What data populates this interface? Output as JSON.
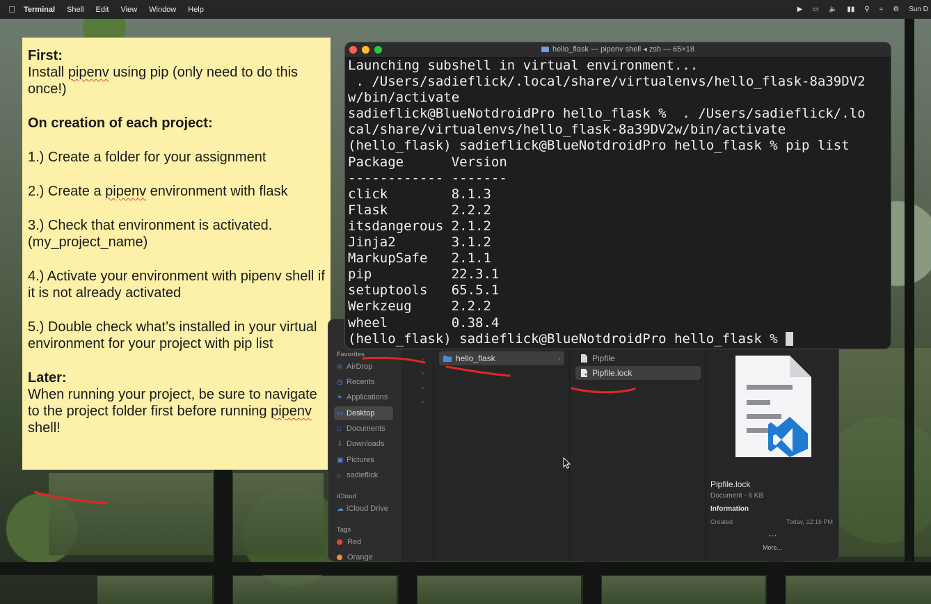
{
  "menubar": {
    "app": "Terminal",
    "items": [
      "Shell",
      "Edit",
      "View",
      "Window",
      "Help"
    ],
    "status_icons": [
      "play-icon",
      "display-icon",
      "volume-icon",
      "battery-icon",
      "search-icon",
      "wifi-icon",
      "control-center-icon"
    ],
    "clock": "Sun D"
  },
  "sticky": {
    "h1": "First:",
    "install_pre": "Install ",
    "install_word": "pipenv",
    "install_post": " using pip (only need to do this once!)",
    "h2": "On creation of each project:",
    "step1": "1.) Create a folder for your assignment",
    "step2_pre": "2.) Create a ",
    "step2_word": "pipenv",
    "step2_post": " environment with flask",
    "step3": "3.) Check that environment is activated. (my_project_name)",
    "step4": "4.) Activate your environment with pipenv shell if it is not already activated",
    "step5": "5.) Double check what’s installed in your virtual environment for your project with pip list",
    "h3": "Later:",
    "later_pre": "When running your project, be sure to navigate to the project folder first before running ",
    "later_word": "pipenv",
    "later_post": " shell!"
  },
  "terminal": {
    "title": "hello_flask — pipenv shell ◂ zsh — 65×18",
    "lines": [
      "Launching subshell in virtual environment...",
      " . /Users/sadieflick/.local/share/virtualenvs/hello_flask-8a39DV2",
      "w/bin/activate",
      "sadieflick@BlueNotdroidPro hello_flask %  . /Users/sadieflick/.lo",
      "cal/share/virtualenvs/hello_flask-8a39DV2w/bin/activate",
      "(hello_flask) sadieflick@BlueNotdroidPro hello_flask % pip list",
      "Package      Version",
      "------------ -------",
      "click        8.1.3",
      "Flask        2.2.2",
      "itsdangerous 2.1.2",
      "Jinja2       3.1.2",
      "MarkupSafe   2.1.1",
      "pip          22.3.1",
      "setuptools   65.5.1",
      "Werkzeug     2.2.2",
      "wheel        0.38.4",
      "(hello_flask) sadieflick@BlueNotdroidPro hello_flask % "
    ]
  },
  "finder": {
    "sidebar": {
      "favorites_label": "Favorites",
      "favorites": [
        "AirDrop",
        "Recents",
        "Applications",
        "Desktop",
        "Documents",
        "Downloads",
        "Pictures",
        "sadieflick"
      ],
      "selected": "Desktop",
      "icloud_label": "iCloud",
      "icloud": [
        "iCloud Drive"
      ],
      "tags_label": "Tags",
      "tags": [
        {
          "name": "Red",
          "color": "#e0443e"
        },
        {
          "name": "Orange",
          "color": "#f0912f"
        }
      ]
    },
    "column1": [
      {
        "name": "hello_flask",
        "kind": "folder"
      }
    ],
    "column2": [
      {
        "name": "Pipfile",
        "kind": "file"
      },
      {
        "name": "Pipfile.lock",
        "kind": "file"
      }
    ],
    "preview": {
      "name": "Pipfile.lock",
      "kind": "Document - 6 KB",
      "info_label": "Information",
      "created_label": "Created",
      "created_value": "Today, 12:16 PM",
      "more_label": "More..."
    }
  },
  "colors": {
    "sticky": "#fdf0a8",
    "terminal_bg": "#1e1e1e",
    "annotation_red": "#e0262a",
    "folder_blue": "#4f8ad6"
  }
}
